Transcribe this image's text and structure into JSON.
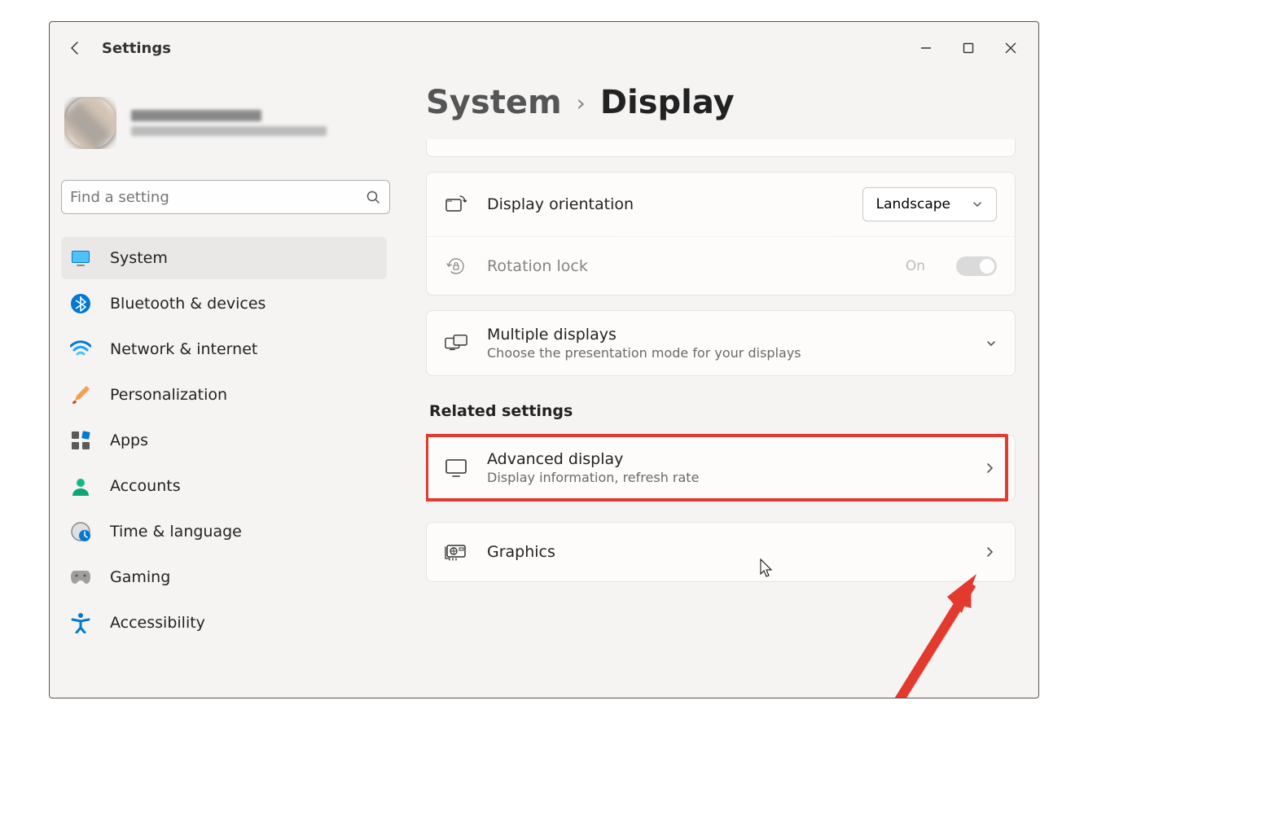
{
  "app": {
    "title": "Settings"
  },
  "search": {
    "placeholder": "Find a setting"
  },
  "sidebar": {
    "items": [
      {
        "label": "System"
      },
      {
        "label": "Bluetooth & devices"
      },
      {
        "label": "Network & internet"
      },
      {
        "label": "Personalization"
      },
      {
        "label": "Apps"
      },
      {
        "label": "Accounts"
      },
      {
        "label": "Time & language"
      },
      {
        "label": "Gaming"
      },
      {
        "label": "Accessibility"
      }
    ],
    "active_index": 0
  },
  "breadcrumb": {
    "parent": "System",
    "current": "Display"
  },
  "settings": {
    "orientation": {
      "title": "Display orientation",
      "value": "Landscape"
    },
    "rotation_lock": {
      "title": "Rotation lock",
      "state_label": "On"
    },
    "multiple_displays": {
      "title": "Multiple displays",
      "sub": "Choose the presentation mode for your displays"
    }
  },
  "related": {
    "heading": "Related settings",
    "advanced": {
      "title": "Advanced display",
      "sub": "Display information, refresh rate"
    },
    "graphics": {
      "title": "Graphics"
    }
  }
}
